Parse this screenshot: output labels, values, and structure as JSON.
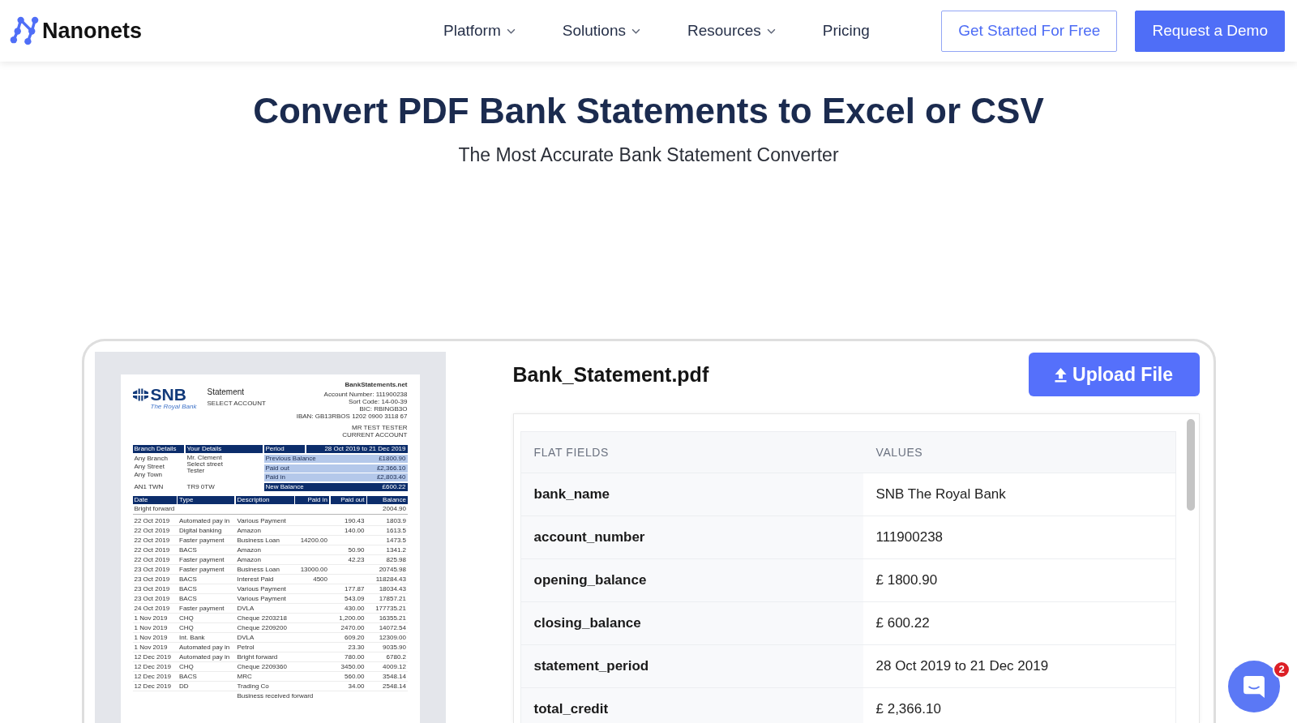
{
  "header": {
    "logo": "Nanonets",
    "nav": [
      {
        "label": "Platform",
        "dropdown": true
      },
      {
        "label": "Solutions",
        "dropdown": true
      },
      {
        "label": "Resources",
        "dropdown": true
      },
      {
        "label": "Pricing",
        "dropdown": false
      }
    ],
    "buttons": [
      {
        "label": "Get Started For Free",
        "kind": "outline"
      },
      {
        "label": "Request a Demo",
        "kind": "filled"
      }
    ]
  },
  "hero": {
    "title": "Convert PDF Bank Statements to Excel or CSV",
    "subtitle": "The Most Accurate Bank Statement Converter"
  },
  "preview": {
    "document": {
      "bank_logo": "SNB",
      "bank_tagline": "The Royal Bank",
      "doc_title": "Statement",
      "account_label": "SELECT ACCOUNT",
      "issuer_lines": [
        "BankStatements.net",
        "Account Number: 111900238",
        "Sort Code: 14-00-39",
        "BIC: RBINGB3O",
        "IBAN: GB13RBOS 1202 0900 3118 67"
      ],
      "holder_lines": [
        "MR TEST TESTER",
        "CURRENT ACCOUNT"
      ],
      "details_headers": [
        "Branch Details",
        "Your Details"
      ],
      "branch_lines": [
        "Any Branch",
        "Any Street",
        "Any Town",
        "AN1 TWN"
      ],
      "your_lines": [
        "Mr. Clement",
        "Select street",
        "Tester",
        "TR9 0TW"
      ],
      "period": {
        "label": "Period",
        "value": "28 Oct 2019 to 21 Dec 2019"
      },
      "summary": [
        {
          "label": "Previous Balance",
          "value": "£1800.90",
          "kind": "light"
        },
        {
          "label": "Paid out",
          "value": "£2,366.10",
          "kind": "light"
        },
        {
          "label": "Paid in",
          "value": "£2,803.40",
          "kind": "light"
        },
        {
          "label": "New Balance",
          "value": "£600.22",
          "kind": "dark"
        }
      ],
      "transaction_columns": [
        "Date",
        "Type",
        "Description",
        "Paid in",
        "Paid out",
        "Balance"
      ],
      "brought_forward": {
        "label": "Bright forward",
        "balance": "2004.90"
      },
      "transactions": [
        {
          "date": "22 Oct 2019",
          "type": "Automated pay in",
          "description": "Various Payment",
          "paid_out": "190.43",
          "balance": "1803.9"
        },
        {
          "date": "22 Oct 2019",
          "type": "Digital banking",
          "description": "Amazon",
          "paid_out": "140.00",
          "balance": "1613.5"
        },
        {
          "date": "22 Oct 2019",
          "type": "Faster payment",
          "description": "Business Loan",
          "paid_in": "14200.00",
          "balance": "1473.5"
        },
        {
          "date": "22 Oct 2019",
          "type": "BACS",
          "description": "Amazon",
          "paid_out": "50.90",
          "balance": "1341.2"
        },
        {
          "date": "22 Oct 2019",
          "type": "Faster payment",
          "description": "Amazon",
          "paid_out": "42.23",
          "balance": "825.98"
        },
        {
          "date": "23 Oct 2019",
          "type": "Faster payment",
          "description": "Business Loan",
          "paid_in": "13000.00",
          "balance": "20745.98"
        },
        {
          "date": "23 Oct 2019",
          "type": "BACS",
          "description": "Interest Paid",
          "paid_in": "4500",
          "balance": "118284.43"
        },
        {
          "date": "23 Oct 2019",
          "type": "BACS",
          "description": "Various Payment",
          "paid_out": "177.87",
          "balance": "18034.43"
        },
        {
          "date": "23 Oct 2019",
          "type": "BACS",
          "description": "Various Payment",
          "paid_out": "543.09",
          "balance": "17857.21"
        },
        {
          "date": "24 Oct 2019",
          "type": "Faster payment",
          "description": "DVLA",
          "paid_out": "430.00",
          "balance": "177735.21"
        },
        {
          "date": "1 Nov 2019",
          "type": "CHQ",
          "description": "Cheque 2203218",
          "paid_out": "1,200.00",
          "balance": "16355.21"
        },
        {
          "date": "1 Nov 2019",
          "type": "CHQ",
          "description": "Cheque 2209200",
          "paid_out": "2470.00",
          "balance": "14072.54"
        },
        {
          "date": "1 Nov 2019",
          "type": "Int. Bank",
          "description": "DVLA",
          "paid_out": "609.20",
          "balance": "12309.00"
        },
        {
          "date": "1 Nov 2019",
          "type": "Automated pay in",
          "description": "Petrol",
          "paid_out": "23.30",
          "balance": "9035.90"
        },
        {
          "date": "12 Dec 2019",
          "type": "Automated pay in",
          "description": "Bright forward",
          "paid_out": "780.00",
          "balance": "6780.2"
        },
        {
          "date": "12 Dec 2019",
          "type": "CHQ",
          "description": "Cheque 2209360",
          "paid_out": "3450.00",
          "balance": "4009.12"
        },
        {
          "date": "12 Dec 2019",
          "type": "BACS",
          "description": "MRC",
          "paid_out": "560.00",
          "balance": "3548.14"
        },
        {
          "date": "12 Dec 2019",
          "type": "DD",
          "description": "Trading Co",
          "paid_out": "34.00",
          "balance": "2548.14"
        }
      ],
      "footer_note": "Business received forward"
    }
  },
  "extraction": {
    "file_name": "Bank_Statement.pdf",
    "upload_button": "Upload File",
    "table": {
      "columns": [
        "FLAT FIELDS",
        "VALUES"
      ],
      "rows": [
        {
          "field": "bank_name",
          "value": "SNB The Royal Bank"
        },
        {
          "field": "account_number",
          "value": "111900238"
        },
        {
          "field": "opening_balance",
          "value": "£ 1800.90"
        },
        {
          "field": "closing_balance",
          "value": "£ 600.22"
        },
        {
          "field": "statement_period",
          "value": "28 Oct 2019 to 21 Dec 2019"
        },
        {
          "field": "total_credit",
          "value": "£ 2,366.10"
        }
      ]
    }
  },
  "chat": {
    "badge": "2"
  }
}
